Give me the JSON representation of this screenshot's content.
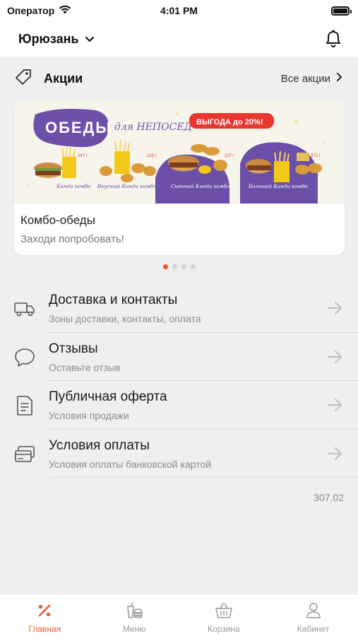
{
  "status_bar": {
    "carrier": "Оператор",
    "time": "4:01 PM"
  },
  "header": {
    "city": "Юрюзань"
  },
  "promo": {
    "title": "Акции",
    "all_label": "Все акции",
    "banner": {
      "headline": "ОБЕДЫ",
      "headline_script": "для НЕПОСЕД",
      "badge": "ВЫГОДА до 20%!",
      "combos": [
        {
          "name": "Кинди комбо",
          "price": "247 г"
        },
        {
          "name": "Вкусный Кинди комбо",
          "price": "215 г"
        },
        {
          "name": "Сытный Кинди комбо",
          "price": "237 г"
        },
        {
          "name": "Большой Кинди комбо",
          "price": "372 г"
        }
      ]
    },
    "card_title": "Комбо-обеды",
    "card_subtitle": "Заходи попробовать!",
    "pages": 4,
    "active_page": 0
  },
  "menu": [
    {
      "title": "Доставка и контакты",
      "subtitle": "Зоны доставки, контакты, оплата",
      "icon": "truck-icon"
    },
    {
      "title": "Отзывы",
      "subtitle": "Оставьте отзыв",
      "icon": "speech-bubble-icon"
    },
    {
      "title": "Публичная оферта",
      "subtitle": "Условия продажи",
      "icon": "document-icon"
    },
    {
      "title": "Условия оплаты",
      "subtitle": "Условия оплаты банковской картой",
      "icon": "credit-cards-icon"
    }
  ],
  "version": "307.02",
  "tabs": [
    {
      "label": "Главная",
      "icon": "percent-icon",
      "active": true
    },
    {
      "label": "Меню",
      "icon": "food-menu-icon",
      "active": false
    },
    {
      "label": "Корзина",
      "icon": "basket-icon",
      "active": false
    },
    {
      "label": "Кабинет",
      "icon": "user-icon",
      "active": false
    }
  ],
  "colors": {
    "accent": "#f2542d",
    "banner_purple": "#6c4fa8",
    "badge_red": "#e8372e"
  }
}
